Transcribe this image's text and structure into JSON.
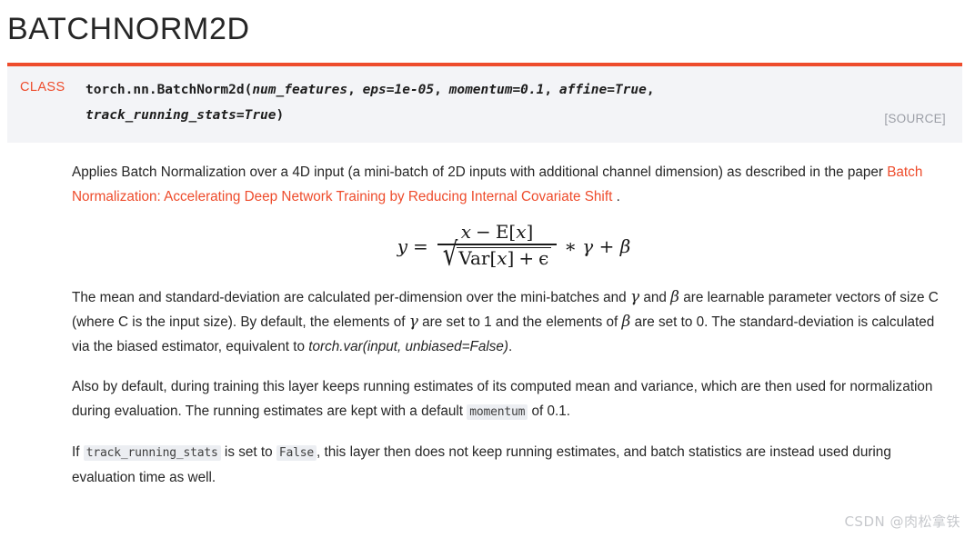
{
  "page": {
    "title": "BATCHNORM2D",
    "accent_color": "#ee4c2c",
    "signature_bg": "#f3f4f7",
    "text_color": "#262626"
  },
  "signature": {
    "class_keyword": "CLASS",
    "qualified_name": "torch.nn.BatchNorm2d(",
    "params": [
      "num_features",
      "eps=1e-05",
      "momentum=0.1",
      "affine=True",
      "track_running_stats=True"
    ],
    "line1": "torch.nn.BatchNorm2d(num_features, eps=1e-05, momentum=0.1, affine=True,",
    "line2": "track_running_stats=True)",
    "closing_paren": ")",
    "source_label": "[SOURCE]"
  },
  "paragraphs": {
    "p1_a": "Applies Batch Normalization over a 4D input (a mini-batch of 2D inputs with additional channel dimension) as described in the paper ",
    "p1_link": "Batch Normalization: Accelerating Deep Network Training by Reducing Internal Covariate Shift",
    "p1_b": " .",
    "p2_a": "The mean and standard-deviation are calculated per-dimension over the mini-batches and ",
    "p2_gamma": "γ",
    "p2_b": " and ",
    "p2_beta": "β",
    "p2_c": " are learnable parameter vectors of size C (where C is the input size). By default, the elements of ",
    "p2_gamma2": "γ",
    "p2_d": " are set to 1 and the elements of ",
    "p2_beta2": "β",
    "p2_e": " are set to 0. The standard-deviation is calculated via the biased estimator, equivalent to ",
    "p2_italic": "torch.var(input, unbiased=False)",
    "p2_f": ".",
    "p3_a": "Also by default, during training this layer keeps running estimates of its computed mean and variance, which are then used for normalization during evaluation. The running estimates are kept with a default ",
    "p3_code": "momentum",
    "p3_b": " of 0.1.",
    "p4_a": "If ",
    "p4_code1": "track_running_stats",
    "p4_b": " is set to ",
    "p4_code2": "False",
    "p4_c": ", this layer then does not keep running estimates, and batch statistics are instead used during evaluation time as well."
  },
  "formula": {
    "latex": "y = \\frac{x - \\mathrm{E}[x]}{\\sqrt{\\mathrm{Var}[x] + \\epsilon}} * \\gamma + \\beta",
    "lhs": "y",
    "equals": "=",
    "numerator_x": "x",
    "numerator_minus": "−",
    "numerator_expectation": "E",
    "numerator_bracket_open": "[",
    "numerator_var": "x",
    "numerator_bracket_close": "]",
    "radical": "√",
    "denominator_var_fn": "Var",
    "denominator_bracket_open": "[",
    "denominator_var": "x",
    "denominator_bracket_close": "]",
    "denominator_plus": "+",
    "denominator_epsilon": "ϵ",
    "tail_times": "∗",
    "tail_gamma": "γ",
    "tail_plus": "+",
    "tail_beta": "β"
  },
  "watermark": {
    "text": "CSDN @肉松拿铁"
  }
}
